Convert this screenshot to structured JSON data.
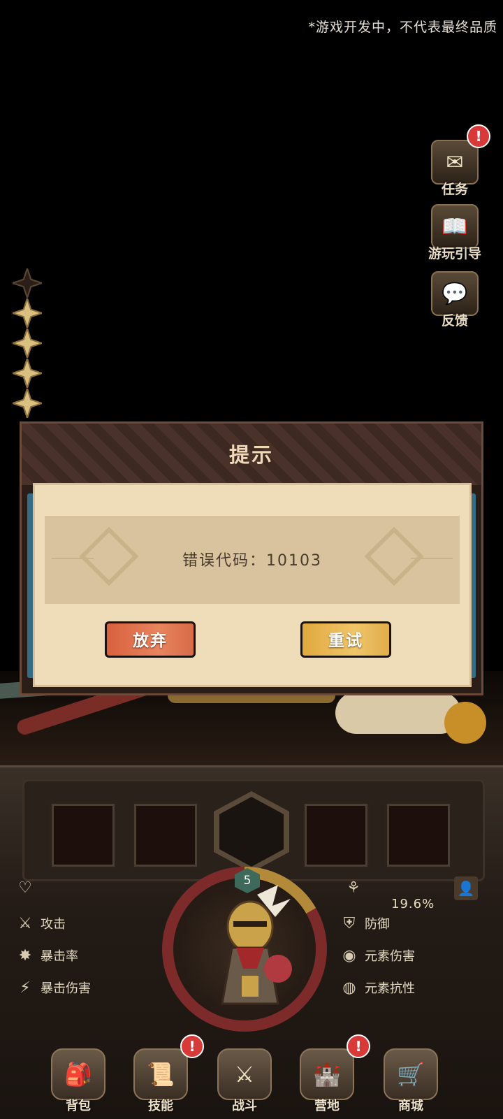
{
  "notice": "*游戏开发中，不代表最终品质",
  "side_menu": [
    {
      "label": "任务",
      "icon": "quest-scroll-icon",
      "badge": "!"
    },
    {
      "label": "游玩引导",
      "icon": "guide-book-icon"
    },
    {
      "label": "反馈",
      "icon": "feedback-chat-icon"
    }
  ],
  "stars": {
    "total": 5,
    "filled": 4
  },
  "player": {
    "level": "5",
    "crit_chance": "19.6%",
    "stats_left": [
      "攻击",
      "暴击率",
      "暴击伤害"
    ],
    "stats_right": [
      "防御",
      "元素伤害",
      "元素抗性"
    ],
    "hp_progress": 0.25
  },
  "bottom_nav": [
    {
      "label": "背包",
      "icon": "backpack-icon"
    },
    {
      "label": "技能",
      "icon": "skill-book-icon",
      "badge": "!"
    },
    {
      "label": "战斗",
      "icon": "battle-icon"
    },
    {
      "label": "营地",
      "icon": "camp-castle-icon",
      "badge": "!"
    },
    {
      "label": "商城",
      "icon": "shop-icon"
    }
  ],
  "dialog": {
    "title": "提示",
    "message": "错误代码：10103",
    "abandon_label": "放弃",
    "retry_label": "重试"
  }
}
